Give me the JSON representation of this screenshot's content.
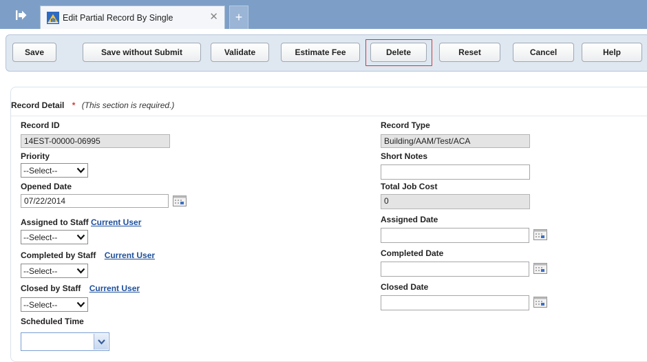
{
  "tab": {
    "title": "Edit Partial Record By Single",
    "close_glyph": "✕",
    "add_glyph": "+"
  },
  "toolbar": {
    "buttons": [
      {
        "label": "Save"
      },
      {
        "label": "Save without Submit"
      },
      {
        "label": "Validate"
      },
      {
        "label": "Estimate Fee"
      },
      {
        "label": "Delete"
      },
      {
        "label": "Reset"
      },
      {
        "label": "Cancel"
      },
      {
        "label": "Help"
      }
    ]
  },
  "section": {
    "title": "Record Detail",
    "required_mark": "*",
    "required_note": "(This section is required.)"
  },
  "left": {
    "record_id_label": "Record ID",
    "record_id_value": "14EST-00000-06995",
    "priority_label": "Priority",
    "priority_value": "--Select--",
    "opened_date_label": "Opened Date",
    "opened_date_value": "07/22/2014",
    "assigned_staff_label": "Assigned to Staff",
    "assigned_staff_link": "Current User",
    "assigned_staff_value": "--Select--",
    "completed_staff_label": "Completed by Staff",
    "completed_staff_link": "Current User",
    "completed_staff_value": "--Select--",
    "closed_staff_label": "Closed by Staff",
    "closed_staff_link": "Current User",
    "closed_staff_value": "--Select--",
    "scheduled_time_label": "Scheduled Time",
    "scheduled_time_value": ""
  },
  "right": {
    "record_type_label": "Record Type",
    "record_type_value": "Building/AAM/Test/ACA",
    "short_notes_label": "Short Notes",
    "short_notes_value": "",
    "total_job_cost_label": "Total Job Cost",
    "total_job_cost_value": "0",
    "assigned_date_label": "Assigned Date",
    "assigned_date_value": "",
    "completed_date_label": "Completed Date",
    "completed_date_value": "",
    "closed_date_label": "Closed Date",
    "closed_date_value": ""
  },
  "colors": {
    "tabbar": "#7d9fc7",
    "toolbar": "#dfe7f1",
    "required": "#d43a3a",
    "link": "#1d4f9c",
    "delete_outline": "#c93a3a"
  },
  "icons": {
    "sidebar_toggle": "sidebar-toggle-icon",
    "tab": "building-icon",
    "calendar": "calendar-icon",
    "chevron": "chevron-down-icon"
  }
}
